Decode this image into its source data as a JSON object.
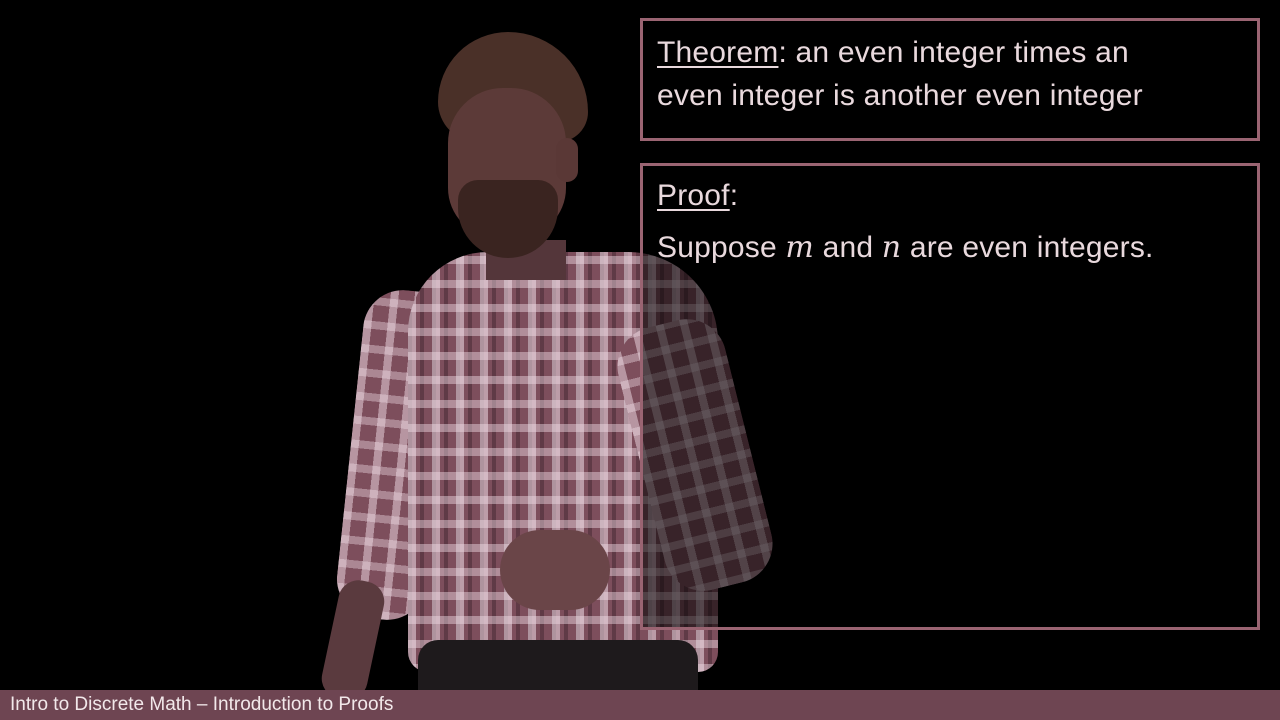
{
  "theorem": {
    "label": "Theorem",
    "line1_rest": ": an even integer times an",
    "line2": "even integer is another even integer"
  },
  "proof": {
    "label": "Proof",
    "colon": ":",
    "line1": {
      "word1": "Suppose ",
      "var1": "m",
      "word2": " and ",
      "var2": "n",
      "word3": " are even integers."
    }
  },
  "footer": {
    "caption": "Intro to Discrete Math – Introduction to Proofs"
  },
  "colors": {
    "box_border": "#9a6472",
    "caption_bar": "#6e4552",
    "text": "#e9d9dd"
  }
}
